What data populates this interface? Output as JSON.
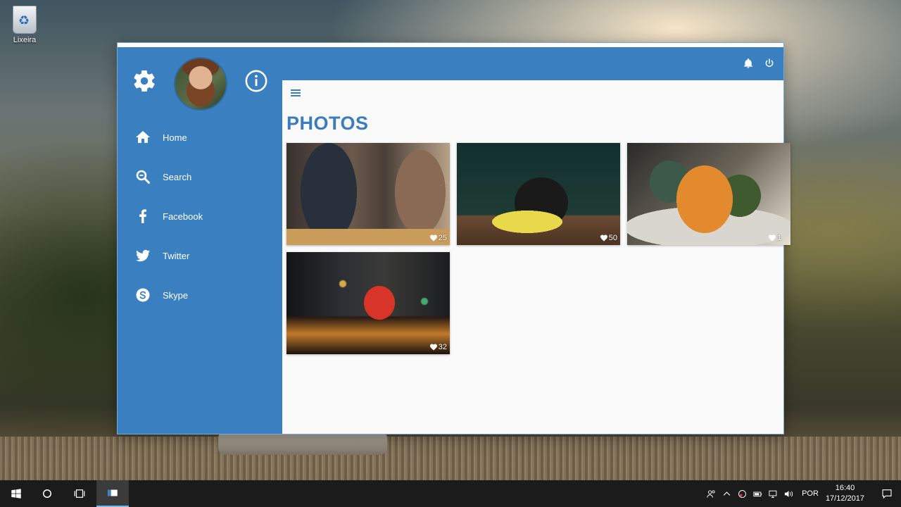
{
  "desktop": {
    "icon_label": "Lixeira"
  },
  "app": {
    "page_title": "PHOTOS",
    "accent_color": "#3a80c0",
    "sidebar": {
      "items": [
        {
          "label": "Home",
          "icon": "home-icon"
        },
        {
          "label": "Search",
          "icon": "search-icon"
        },
        {
          "label": "Facebook",
          "icon": "facebook-icon"
        },
        {
          "label": "Twitter",
          "icon": "twitter-icon"
        },
        {
          "label": "Skype",
          "icon": "skype-icon"
        }
      ]
    },
    "photos": [
      {
        "subject": "people-with-coffee",
        "likes": "25"
      },
      {
        "subject": "coffee-cup-flowers",
        "likes": "50"
      },
      {
        "subject": "pumpkins",
        "likes": "1"
      },
      {
        "subject": "city-tram-night",
        "likes": "32"
      }
    ]
  },
  "taskbar": {
    "language": "POR",
    "time": "16:40",
    "date": "17/12/2017"
  }
}
